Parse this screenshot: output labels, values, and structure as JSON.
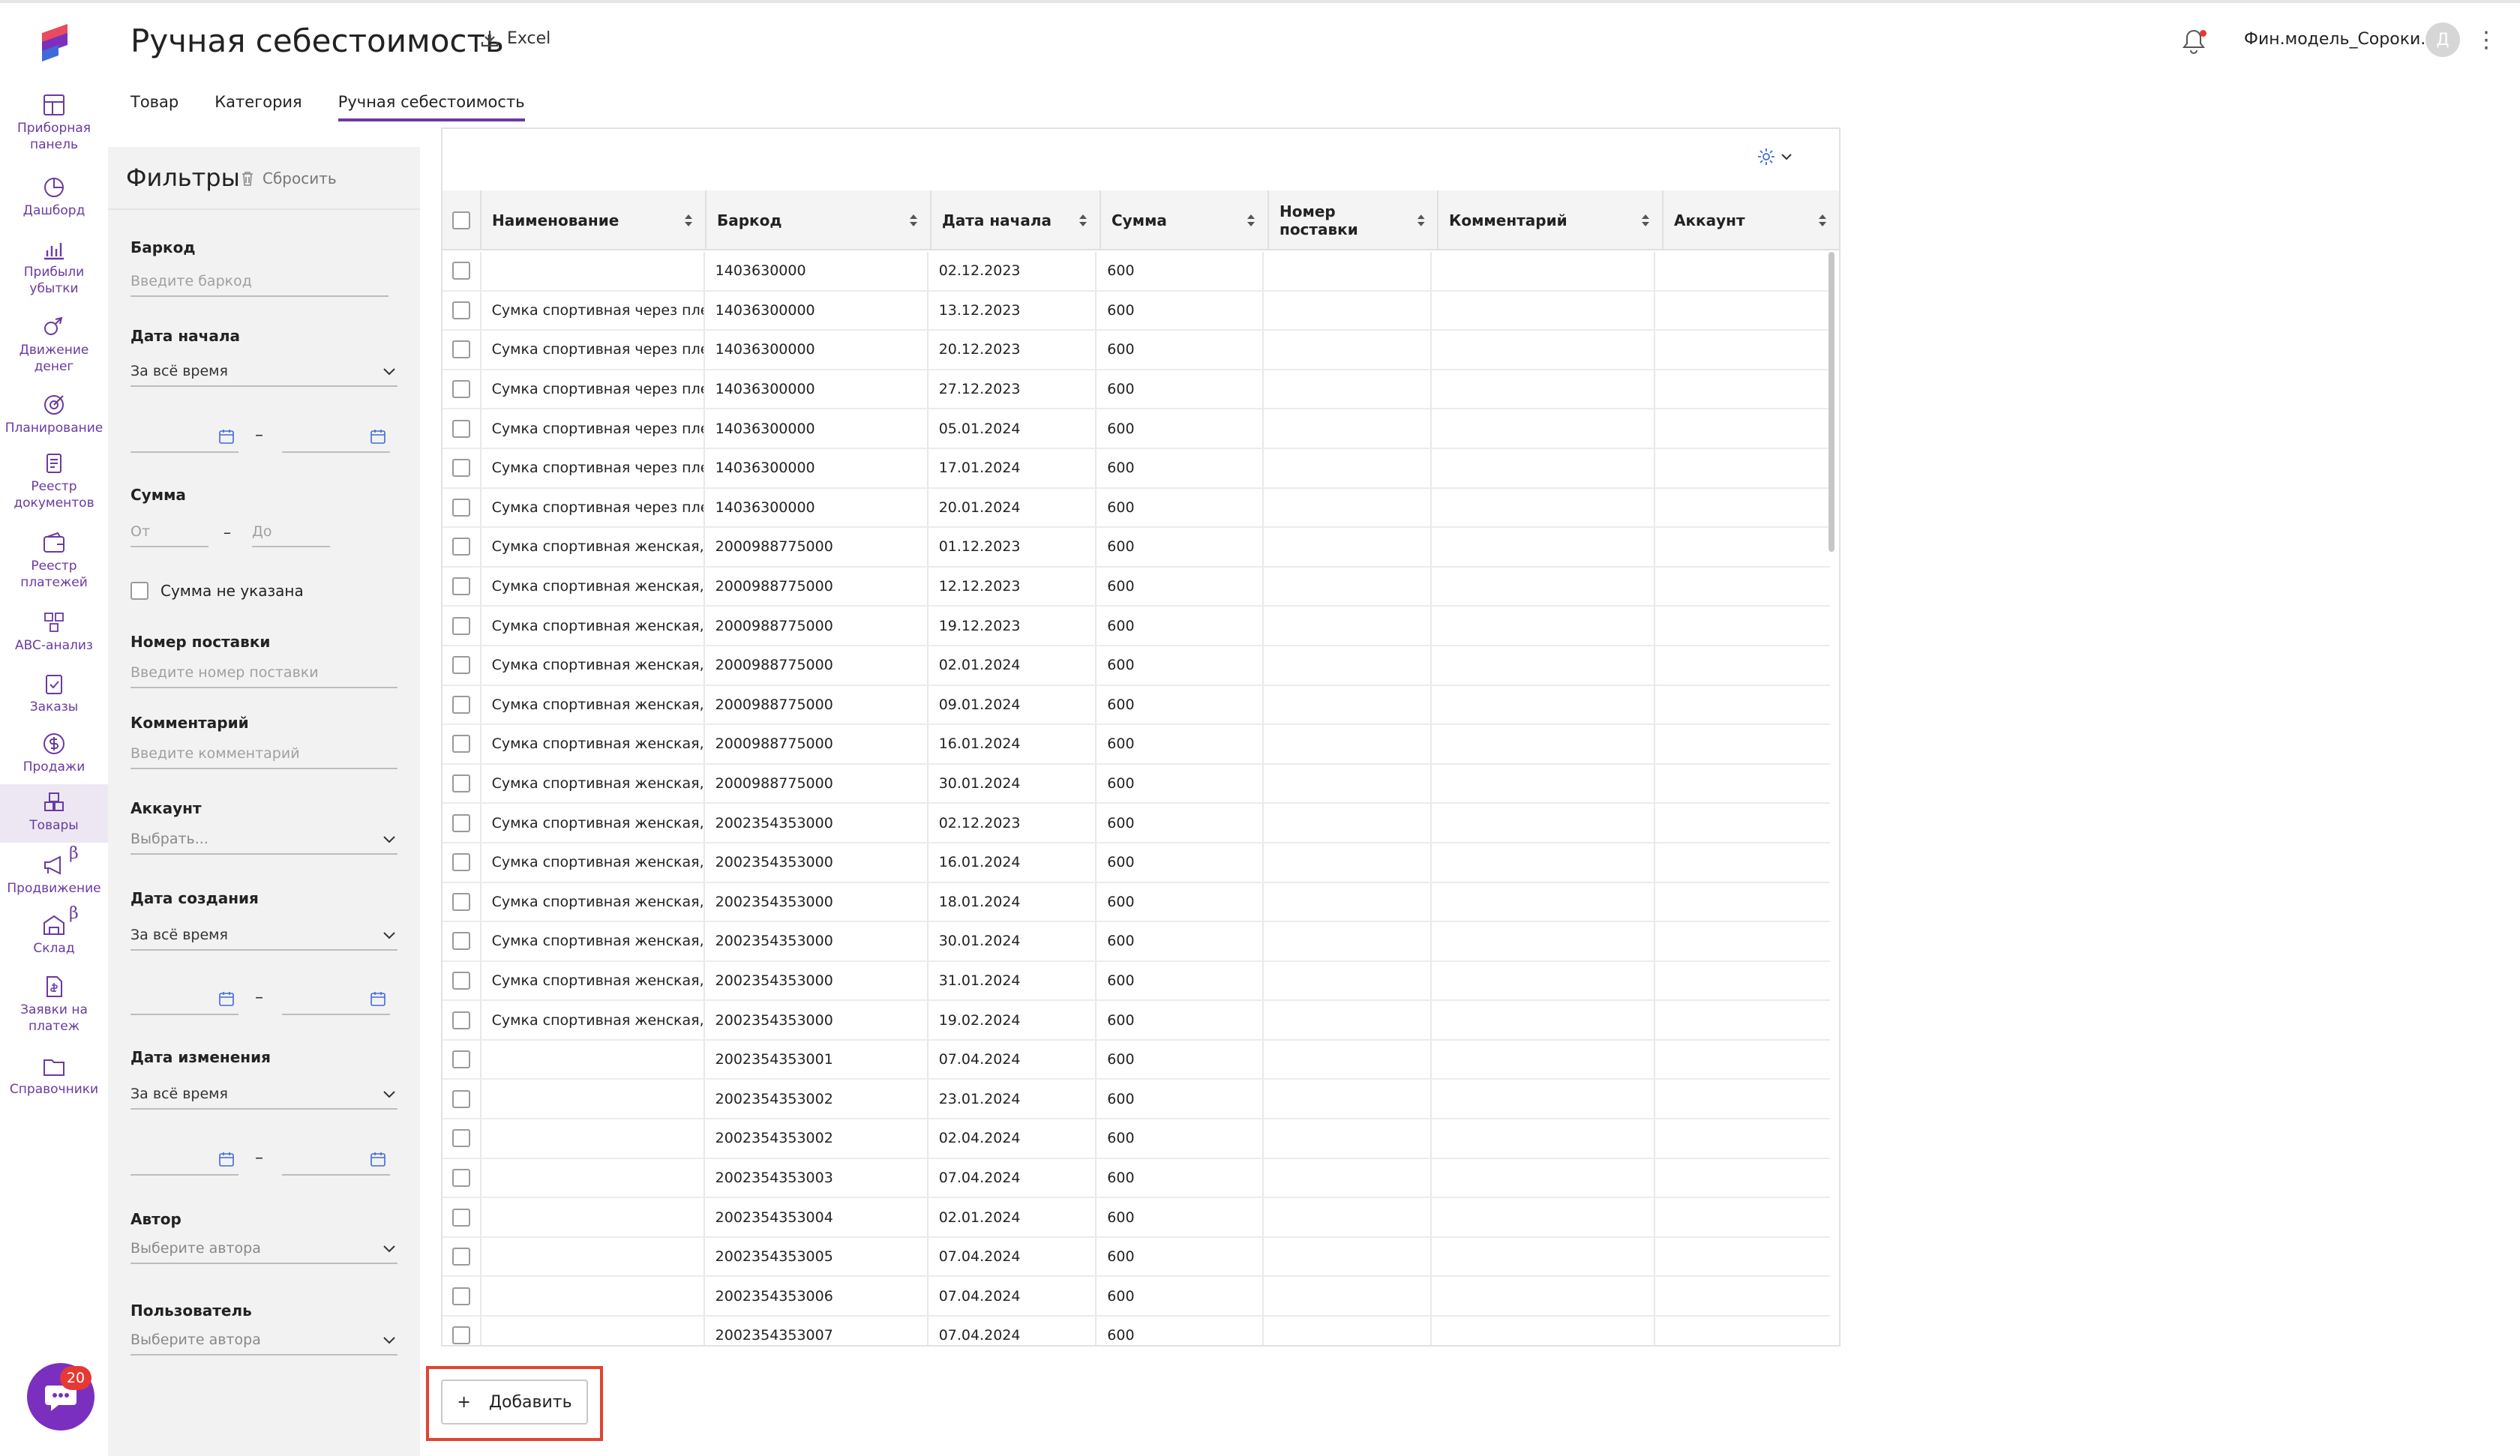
{
  "nav": {
    "items": [
      {
        "label": "Приборная\nпанель",
        "icon": "dashboard-panel-icon"
      },
      {
        "label": "Дашборд",
        "icon": "pie-chart-icon"
      },
      {
        "label": "Прибыли\nубытки",
        "icon": "bar-chart-icon"
      },
      {
        "label": "Движение\nденег",
        "icon": "money-flow-icon"
      },
      {
        "label": "Планирование",
        "icon": "target-icon"
      },
      {
        "label": "Реестр\nдокументов",
        "icon": "documents-icon"
      },
      {
        "label": "Реестр\nплатежей",
        "icon": "wallet-icon"
      },
      {
        "label": "ABC-анализ",
        "icon": "abc-icon"
      },
      {
        "label": "Заказы",
        "icon": "clipboard-icon"
      },
      {
        "label": "Продажи",
        "icon": "dollar-icon"
      },
      {
        "label": "Товары",
        "icon": "boxes-icon"
      },
      {
        "label": "Продвижение",
        "icon": "megaphone-icon",
        "beta": "β"
      },
      {
        "label": "Склад",
        "icon": "warehouse-icon",
        "beta": "β"
      },
      {
        "label": "Заявки на\nплатеж",
        "icon": "payment-request-icon"
      },
      {
        "label": "Справочники",
        "icon": "folder-icon"
      }
    ],
    "active": "Товары",
    "chat_badge": "20"
  },
  "header": {
    "title": "Ручная себестоимость",
    "excel_label": "Excel",
    "account": "Фин.модель_Сороки...",
    "avatar": "Д"
  },
  "tabs": [
    {
      "label": "Товар",
      "active": false
    },
    {
      "label": "Категория",
      "active": false
    },
    {
      "label": "Ручная себестоимость",
      "active": true
    }
  ],
  "filters": {
    "title": "Фильтры",
    "reset": "Сбросить",
    "barcode_label": "Баркод",
    "barcode_placeholder": "Введите баркод",
    "start_date_label": "Дата начала",
    "start_date_value": "За всё время",
    "sum_label": "Сумма",
    "sum_from": "От",
    "sum_to": "До",
    "sum_missing": "Сумма не указана",
    "supply_label": "Номер поставки",
    "supply_placeholder": "Введите номер поставки",
    "comment_label": "Комментарий",
    "comment_placeholder": "Введите комментарий",
    "account_label": "Аккаунт",
    "account_placeholder": "Выбрать...",
    "created_label": "Дата создания",
    "created_value": "За всё время",
    "modified_label": "Дата изменения",
    "modified_value": "За всё время",
    "author_label": "Автор",
    "author_placeholder": "Выберите автора",
    "user_label": "Пользователь",
    "user_placeholder": "Выберите автора",
    "dash": "–"
  },
  "table": {
    "columns": [
      "Наименование",
      "Баркод",
      "Дата начала",
      "Сумма",
      "Номер поставки",
      "Комментарий",
      "Аккаунт"
    ],
    "rows": [
      [
        "",
        "1403630000",
        "02.12.2023",
        "600"
      ],
      [
        "Сумка спортивная через плеч",
        "14036300000",
        "13.12.2023",
        "600"
      ],
      [
        "Сумка спортивная через плеч",
        "14036300000",
        "20.12.2023",
        "600"
      ],
      [
        "Сумка спортивная через плеч",
        "14036300000",
        "27.12.2023",
        "600"
      ],
      [
        "Сумка спортивная через плеч",
        "14036300000",
        "05.01.2024",
        "600"
      ],
      [
        "Сумка спортивная через плеч",
        "14036300000",
        "17.01.2024",
        "600"
      ],
      [
        "Сумка спортивная через плеч",
        "14036300000",
        "20.01.2024",
        "600"
      ],
      [
        "Сумка спортивная женская, С",
        "2000988775000",
        "01.12.2023",
        "600"
      ],
      [
        "Сумка спортивная женская, С",
        "2000988775000",
        "12.12.2023",
        "600"
      ],
      [
        "Сумка спортивная женская, С",
        "2000988775000",
        "19.12.2023",
        "600"
      ],
      [
        "Сумка спортивная женская, С",
        "2000988775000",
        "02.01.2024",
        "600"
      ],
      [
        "Сумка спортивная женская, С",
        "2000988775000",
        "09.01.2024",
        "600"
      ],
      [
        "Сумка спортивная женская, С",
        "2000988775000",
        "16.01.2024",
        "600"
      ],
      [
        "Сумка спортивная женская, С",
        "2000988775000",
        "30.01.2024",
        "600"
      ],
      [
        "Сумка спортивная женская,Q",
        "2002354353000",
        "02.12.2023",
        "600"
      ],
      [
        "Сумка спортивная женская,Q",
        "2002354353000",
        "16.01.2024",
        "600"
      ],
      [
        "Сумка спортивная женская,Q",
        "2002354353000",
        "18.01.2024",
        "600"
      ],
      [
        "Сумка спортивная женская,Q",
        "2002354353000",
        "30.01.2024",
        "600"
      ],
      [
        "Сумка спортивная женская,Q",
        "2002354353000",
        "31.01.2024",
        "600"
      ],
      [
        "Сумка спортивная женская,Q",
        "2002354353000",
        "19.02.2024",
        "600"
      ],
      [
        "",
        "2002354353001",
        "07.04.2024",
        "600"
      ],
      [
        "",
        "2002354353002",
        "23.01.2024",
        "600"
      ],
      [
        "",
        "2002354353002",
        "02.04.2024",
        "600"
      ],
      [
        "",
        "2002354353003",
        "07.04.2024",
        "600"
      ],
      [
        "",
        "2002354353004",
        "02.01.2024",
        "600"
      ],
      [
        "",
        "2002354353005",
        "07.04.2024",
        "600"
      ],
      [
        "",
        "2002354353006",
        "07.04.2024",
        "600"
      ],
      [
        "",
        "2002354353007",
        "07.04.2024",
        "600"
      ]
    ]
  },
  "add_button": {
    "label": "Добавить",
    "plus": "+"
  },
  "colors": {
    "accent": "#6a3aa0",
    "chat": "#7b2fbe",
    "badge": "#e53935",
    "highlight": "#e0442f"
  }
}
